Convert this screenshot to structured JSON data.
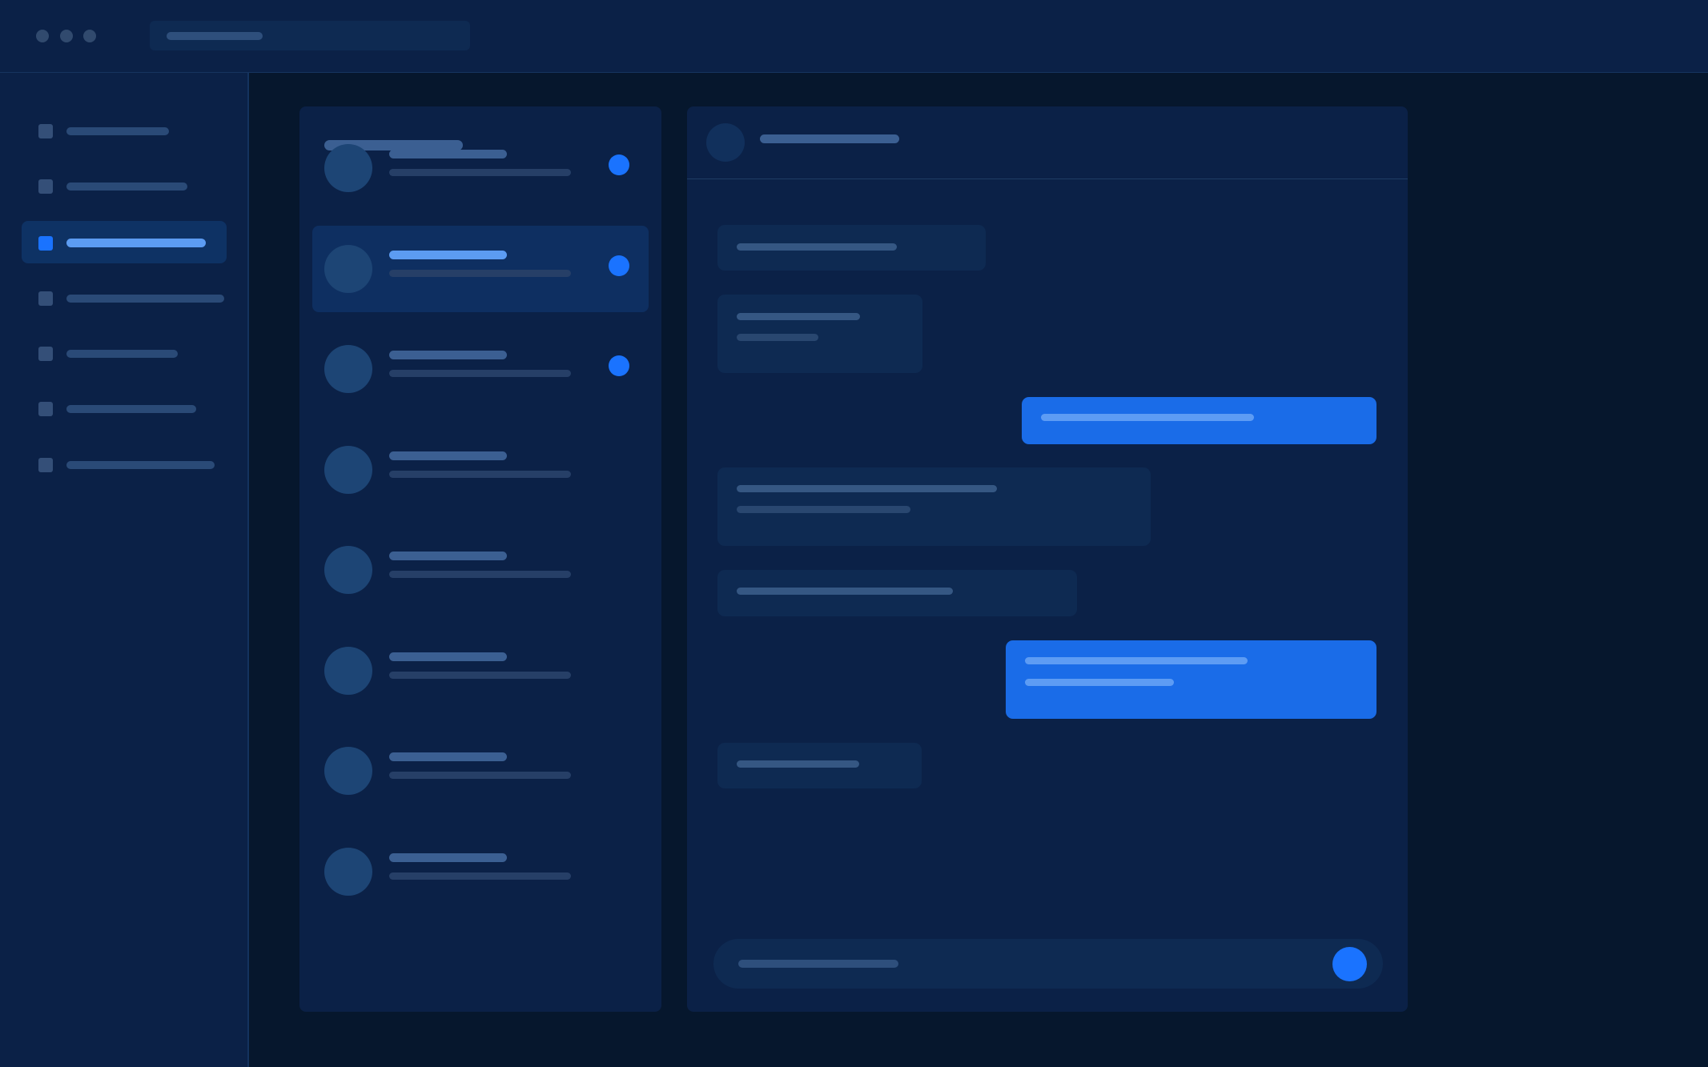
{
  "theme": {
    "background": "#06172d",
    "panel": "#0b2147",
    "accent": "#1a73ff",
    "outgoing_bubble": "#1a6ce8"
  },
  "titlebar": {
    "window_controls": [
      "window-dot-icon",
      "window-dot-icon",
      "window-dot-icon"
    ],
    "address_bar": "placeholder-skeleton"
  },
  "sidebar": {
    "active_index": 2,
    "items": [
      {
        "icon": "nav-square-icon"
      },
      {
        "icon": "nav-square-icon"
      },
      {
        "icon": "nav-square-icon"
      },
      {
        "icon": "nav-square-icon"
      },
      {
        "icon": "nav-square-icon"
      },
      {
        "icon": "nav-square-icon"
      },
      {
        "icon": "nav-square-icon"
      }
    ]
  },
  "conversations": {
    "selected_index": 1,
    "items": [
      {
        "unread": true
      },
      {
        "unread": true
      },
      {
        "unread": true
      },
      {
        "unread": false
      },
      {
        "unread": false
      },
      {
        "unread": false
      },
      {
        "unread": false
      },
      {
        "unread": false
      }
    ]
  },
  "chat": {
    "messages": [
      {
        "direction": "incoming",
        "lines": 1
      },
      {
        "direction": "incoming",
        "lines": 2
      },
      {
        "direction": "outgoing",
        "lines": 1
      },
      {
        "direction": "incoming",
        "lines": 2
      },
      {
        "direction": "incoming",
        "lines": 1
      },
      {
        "direction": "outgoing",
        "lines": 2
      },
      {
        "direction": "incoming",
        "lines": 1
      }
    ],
    "send_icon": "send-icon"
  }
}
